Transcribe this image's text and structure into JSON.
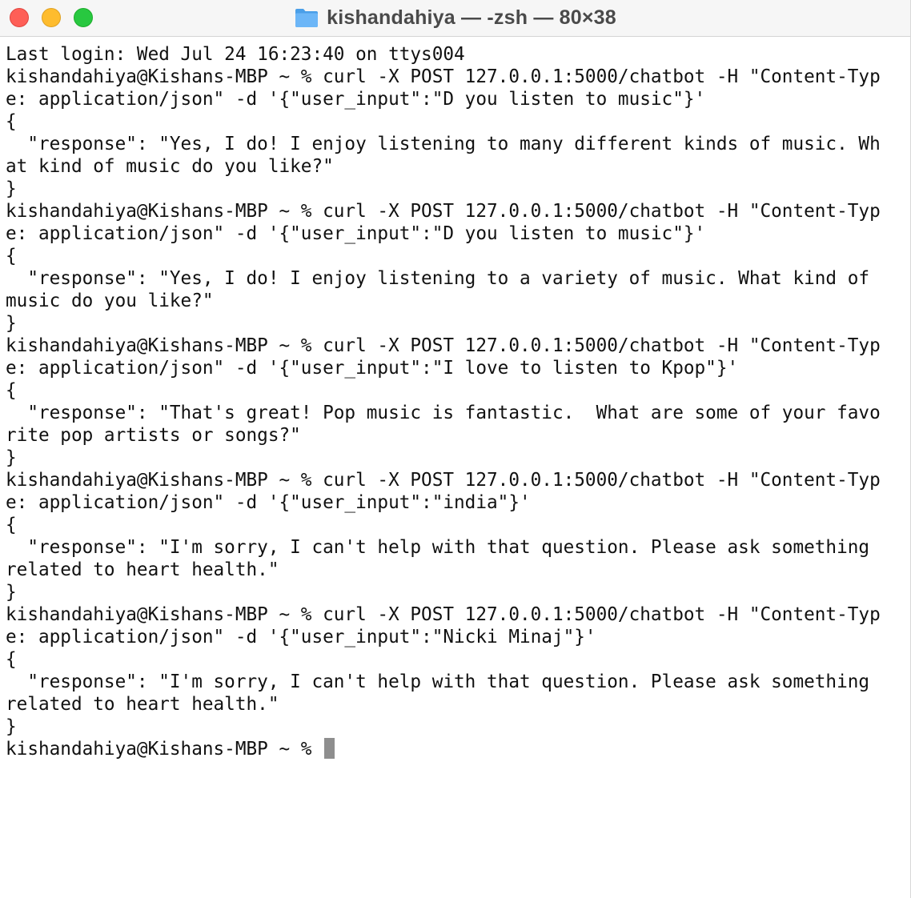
{
  "window": {
    "title": "kishandahiya — -zsh — 80×38",
    "folder_icon": "folder-icon",
    "colors": {
      "close": "#fe5f57",
      "minimize": "#febc2e",
      "zoom": "#28c840",
      "folder": "#5aabf5"
    }
  },
  "terminal": {
    "lines": [
      "Last login: Wed Jul 24 16:23:40 on ttys004",
      "kishandahiya@Kishans-MBP ~ % curl -X POST 127.0.0.1:5000/chatbot -H \"Content-Typ",
      "e: application/json\" -d '{\"user_input\":\"D you listen to music\"}'",
      "{",
      "  \"response\": \"Yes, I do! I enjoy listening to many different kinds of music. Wh",
      "at kind of music do you like?\"",
      "}",
      "kishandahiya@Kishans-MBP ~ % curl -X POST 127.0.0.1:5000/chatbot -H \"Content-Typ",
      "e: application/json\" -d '{\"user_input\":\"D you listen to music\"}'",
      "{",
      "  \"response\": \"Yes, I do! I enjoy listening to a variety of music. What kind of",
      "music do you like?\"",
      "}",
      "kishandahiya@Kishans-MBP ~ % curl -X POST 127.0.0.1:5000/chatbot -H \"Content-Typ",
      "e: application/json\" -d '{\"user_input\":\"I love to listen to Kpop\"}'",
      "{",
      "  \"response\": \"That's great! Pop music is fantastic.  What are some of your favo",
      "rite pop artists or songs?\"",
      "}",
      "kishandahiya@Kishans-MBP ~ % curl -X POST 127.0.0.1:5000/chatbot -H \"Content-Typ",
      "e: application/json\" -d '{\"user_input\":\"india\"}'",
      "{",
      "  \"response\": \"I'm sorry, I can't help with that question. Please ask something",
      "related to heart health.\"",
      "}",
      "kishandahiya@Kishans-MBP ~ % curl -X POST 127.0.0.1:5000/chatbot -H \"Content-Typ",
      "e: application/json\" -d '{\"user_input\":\"Nicki Minaj\"}'",
      "{",
      "  \"response\": \"I'm sorry, I can't help with that question. Please ask something",
      "related to heart health.\"",
      "}"
    ],
    "prompt": "kishandahiya@Kishans-MBP ~ % "
  }
}
